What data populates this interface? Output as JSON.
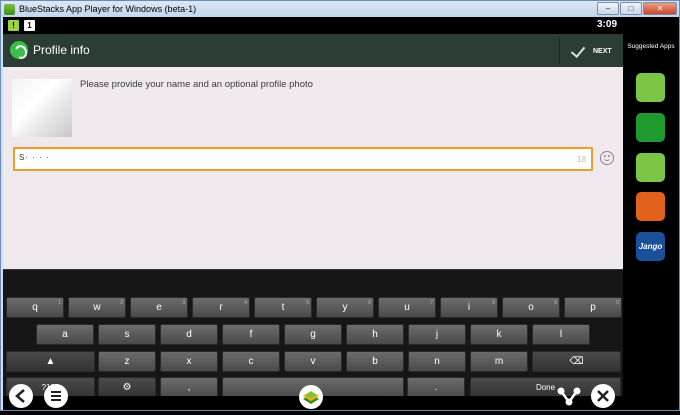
{
  "window": {
    "title": "BlueStacks App Player for Windows (beta-1)",
    "min": "–",
    "max": "□",
    "close": "✕"
  },
  "statusbar": {
    "icon1": "!",
    "icon2": "1",
    "clock": "3:09"
  },
  "actionbar": {
    "title": "Profile info",
    "next_label": "NEXT"
  },
  "content": {
    "prompt": "Please provide your name and an optional profile photo",
    "name_value": "S· · · ·",
    "char_count": "18"
  },
  "keyboard": {
    "row1": [
      [
        "q",
        "1"
      ],
      [
        "w",
        "2"
      ],
      [
        "e",
        "3"
      ],
      [
        "r",
        "4"
      ],
      [
        "t",
        "5"
      ],
      [
        "y",
        "6"
      ],
      [
        "u",
        "7"
      ],
      [
        "i",
        "8"
      ],
      [
        "o",
        "9"
      ],
      [
        "p",
        "0"
      ]
    ],
    "row2": [
      "a",
      "s",
      "d",
      "f",
      "g",
      "h",
      "j",
      "k",
      "l"
    ],
    "row3": [
      "z",
      "x",
      "c",
      "v",
      "b",
      "n",
      "m"
    ],
    "shift": "▲",
    "backspace": "⌫",
    "sym": "?123",
    "settings": "⚙",
    "comma": ",",
    "period": ".",
    "done": "Done"
  },
  "sidebar": {
    "title": "Suggested Apps",
    "apps": [
      {
        "name": "app-1",
        "color": "#7cc646"
      },
      {
        "name": "app-2",
        "color": "#1f9a2f"
      },
      {
        "name": "app-3",
        "color": "#7cc646"
      },
      {
        "name": "app-4",
        "color": "#e2611d"
      },
      {
        "name": "jango",
        "label": "Jango",
        "color": "#1a4f9a"
      }
    ]
  },
  "colors": {
    "accent": "#f29b28",
    "actionbar": "#2b3d35",
    "content_bg": "#efe9ee"
  }
}
